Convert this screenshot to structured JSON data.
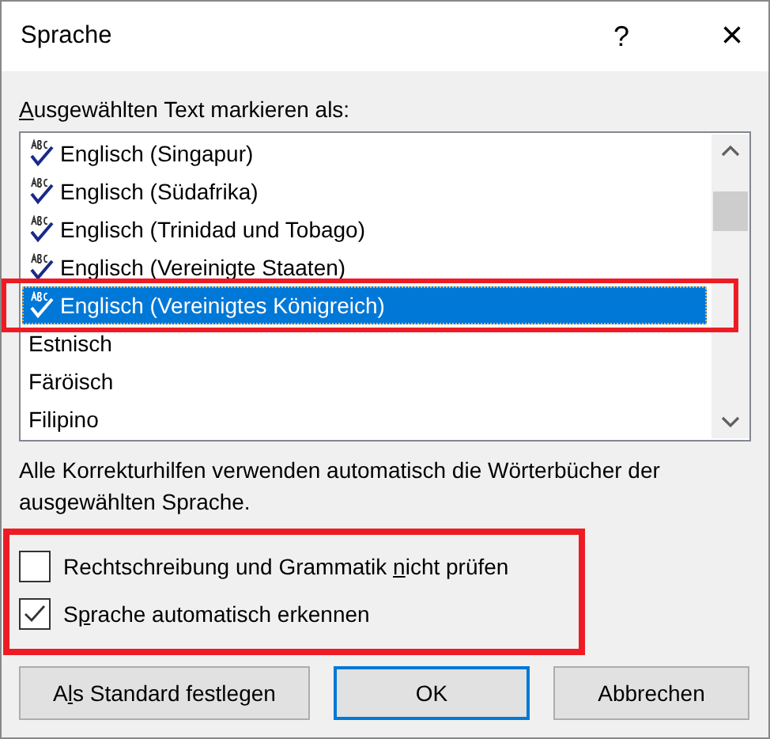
{
  "window": {
    "title": "Sprache",
    "help": "?",
    "close": "×"
  },
  "list_label": {
    "key": "A",
    "after": "usgewählten Text markieren als:"
  },
  "languages": [
    {
      "label": "Englisch (Singapur)",
      "proofing": true,
      "selected": false
    },
    {
      "label": "Englisch (Südafrika)",
      "proofing": true,
      "selected": false
    },
    {
      "label": "Englisch (Trinidad und Tobago)",
      "proofing": true,
      "selected": false
    },
    {
      "label": "Englisch (Vereinigte Staaten)",
      "proofing": true,
      "selected": false
    },
    {
      "label": "Englisch (Vereinigtes Königreich)",
      "proofing": true,
      "selected": true
    },
    {
      "label": "Estnisch",
      "proofing": false,
      "selected": false
    },
    {
      "label": "Färöisch",
      "proofing": false,
      "selected": false
    },
    {
      "label": "Filipino",
      "proofing": false,
      "selected": false
    }
  ],
  "info": "Alle Korrekturhilfen verwenden automatisch die Wörterbücher der ausgewählten Sprache.",
  "options": [
    {
      "before": "Rechtschreibung und Grammatik ",
      "key": "n",
      "after": "icht prüfen",
      "checked": false
    },
    {
      "before": "S",
      "key": "p",
      "after": "rache automatisch erkennen",
      "checked": true
    }
  ],
  "buttons": [
    {
      "before": "A",
      "key": "l",
      "after": "s Standard festlegen",
      "default": false
    },
    {
      "before": "OK",
      "default": true
    },
    {
      "before": "Abbrechen",
      "default": false
    }
  ]
}
